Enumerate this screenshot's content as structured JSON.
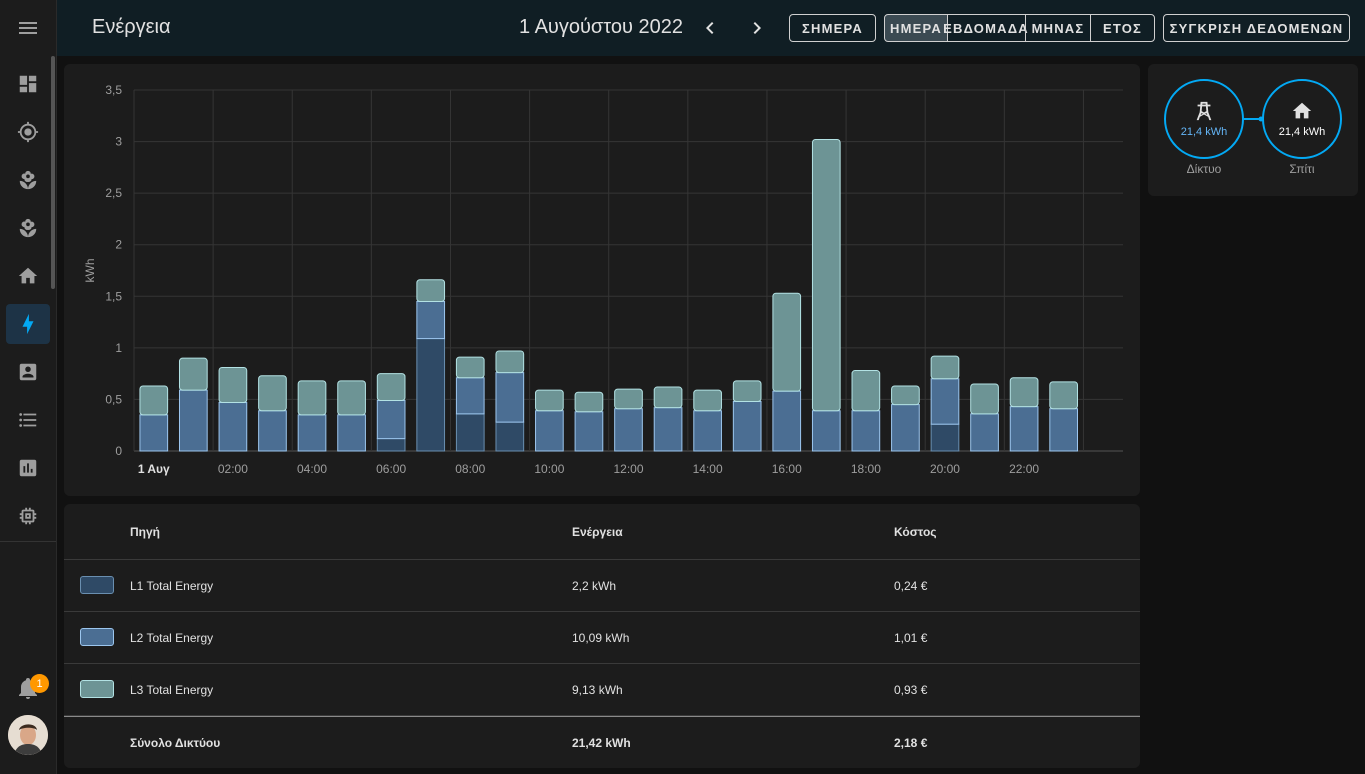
{
  "header": {
    "title": "Ενέργεια",
    "date": "1 Αυγούστου 2022",
    "today_label": "ΣΗΜΕΡΑ",
    "periods": [
      "ΗΜΕΡΑ",
      "ΕΒΔΟΜΑΔΑ",
      "ΜΗΝΑΣ",
      "ΕΤΟΣ"
    ],
    "active_period": "ΗΜΕΡΑ",
    "compare_label": "ΣΥΓΚΡΙΣΗ ΔΕΔΟΜΕΝΩΝ"
  },
  "sidebar": {
    "items": [
      "dashboard-icon",
      "crosshairs-gps-icon",
      "flower-icon",
      "flower-icon",
      "home-icon",
      "lightning-bolt-icon",
      "account-box-icon",
      "format-list-bulleted-icon",
      "chart-box-icon",
      "memory-icon"
    ],
    "active_item": "lightning-bolt-icon",
    "notification_count": "1"
  },
  "chart_data": {
    "type": "bar",
    "stacked": true,
    "ylabel": "kWh",
    "ylim": [
      0,
      3.5
    ],
    "yticks": [
      "0",
      "0,5",
      "1",
      "1,5",
      "2",
      "2,5",
      "3",
      "3,5"
    ],
    "ytick_values": [
      0,
      0.5,
      1,
      1.5,
      2,
      2.5,
      3,
      3.5
    ],
    "xtick_labels": [
      "1 Αυγ",
      "02:00",
      "04:00",
      "06:00",
      "08:00",
      "10:00",
      "12:00",
      "14:00",
      "16:00",
      "18:00",
      "20:00",
      "22:00"
    ],
    "xtick_hours": [
      0,
      2,
      4,
      6,
      8,
      10,
      12,
      14,
      16,
      18,
      20,
      22
    ],
    "categories": [
      "00:00",
      "01:00",
      "02:00",
      "03:00",
      "04:00",
      "05:00",
      "06:00",
      "07:00",
      "08:00",
      "09:00",
      "10:00",
      "11:00",
      "12:00",
      "13:00",
      "14:00",
      "15:00",
      "16:00",
      "17:00",
      "18:00",
      "19:00",
      "20:00",
      "21:00",
      "22:00",
      "23:00"
    ],
    "series": [
      {
        "name": "L1 Total Energy",
        "color": "#2f4a66",
        "values": [
          0,
          0,
          0,
          0,
          0,
          0,
          0.12,
          1.09,
          0.36,
          0.28,
          0,
          0,
          0,
          0,
          0,
          0,
          0,
          0,
          0,
          0,
          0.26,
          0,
          0,
          0
        ]
      },
      {
        "name": "L2 Total Energy",
        "color": "#4b6e93",
        "values": [
          0.35,
          0.59,
          0.47,
          0.39,
          0.35,
          0.35,
          0.37,
          0.36,
          0.35,
          0.48,
          0.39,
          0.38,
          0.41,
          0.42,
          0.39,
          0.48,
          0.58,
          0.39,
          0.39,
          0.45,
          0.44,
          0.36,
          0.43,
          0.41
        ]
      },
      {
        "name": "L3 Total Energy",
        "color": "#6d9495",
        "values": [
          0.28,
          0.31,
          0.34,
          0.34,
          0.33,
          0.33,
          0.26,
          0.21,
          0.2,
          0.21,
          0.2,
          0.19,
          0.19,
          0.2,
          0.2,
          0.2,
          0.95,
          2.63,
          0.39,
          0.18,
          0.22,
          0.29,
          0.28,
          0.26
        ]
      }
    ]
  },
  "table": {
    "headers": [
      "Πηγή",
      "Ενέργεια",
      "Κόστος"
    ],
    "rows": [
      {
        "source": "L1 Total Energy",
        "energy": "2,2 kWh",
        "cost": "0,24 €",
        "color": "#2f4a66"
      },
      {
        "source": "L2 Total Energy",
        "energy": "10,09 kWh",
        "cost": "1,01 €",
        "color": "#4b6e93"
      },
      {
        "source": "L3 Total Energy",
        "energy": "9,13 kWh",
        "cost": "0,93 €",
        "color": "#6d9495"
      }
    ],
    "total": {
      "label": "Σύνολο Δικτύου",
      "energy": "21,42 kWh",
      "cost": "2,18 €"
    }
  },
  "flow": {
    "grid": {
      "value": "21,4 kWh",
      "label": "Δίκτυο"
    },
    "home": {
      "value": "21,4 kWh",
      "label": "Σπίτι"
    }
  }
}
